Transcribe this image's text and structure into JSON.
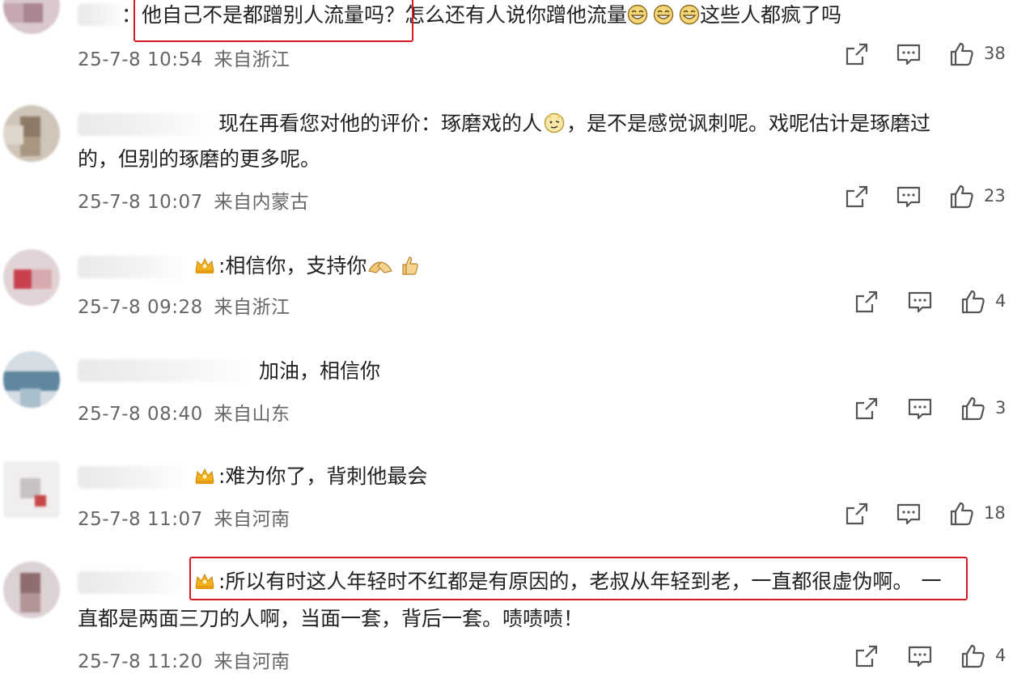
{
  "comments": [
    {
      "text_prefix": "：",
      "text_highlight": "他自己不是都蹭别人流量吗？",
      "text_rest": "怎么还有人说你蹭他流量",
      "text_end": "这些人都疯了吗",
      "time": "25-7-8 10:54",
      "location": "来自浙江",
      "likes": "38"
    },
    {
      "line1": "现在再看您对他的评价：琢磨戏的人",
      "line1_end": "，是不是感觉讽刺呢。戏呢估计是琢磨过",
      "line2": "的，但别的琢磨的更多呢。",
      "time": "25-7-8 10:07",
      "location": "来自内蒙古",
      "likes": "23"
    },
    {
      "text": ":相信你，支持你",
      "time": "25-7-8 09:28",
      "location": "来自浙江",
      "likes": "4"
    },
    {
      "text": "加油，相信你",
      "time": "25-7-8 08:40",
      "location": "来自山东",
      "likes": "3"
    },
    {
      "text": ":难为你了，背刺他最会",
      "time": "25-7-8 11:07",
      "location": "来自河南",
      "likes": "18"
    },
    {
      "line1_highlight": ":所以有时这人年轻时不红都是有原因的，老叔从年轻到老，一直都很虚伪啊。",
      "line1_end": "一",
      "line2": "直都是两面三刀的人啊，当面一套，背后一套。啧啧啧！",
      "time": "25-7-8 11:20",
      "location": "来自河南",
      "likes": "4"
    }
  ],
  "icons": {
    "share": "share-icon",
    "comment": "comment-icon",
    "like": "thumbs-up-icon"
  },
  "colors": {
    "highlight_box": "#d21b23",
    "meta_text": "#666666",
    "icon_stroke": "#555555"
  }
}
